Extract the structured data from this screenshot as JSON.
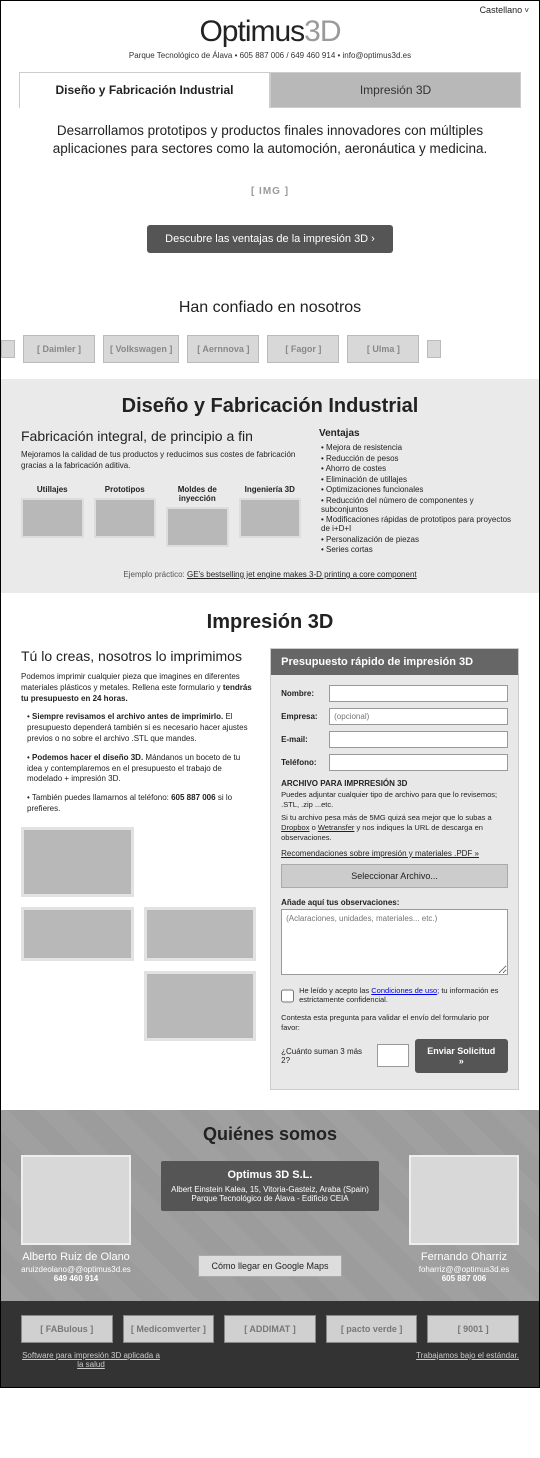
{
  "lang_selector": "Castellano",
  "logo_a": "Optimus",
  "logo_b": "3D",
  "sub_header": "Parque Tecnológico de Álava  •  605 887 006  /  649 460 914   •  info@optimus3d.es",
  "tabs": {
    "left": "Diseño y Fabricación Industrial",
    "right": "Impresión 3D"
  },
  "hero": {
    "headline": "Desarrollamos prototipos y productos finales innovadores con múltiples aplicaciones para sectores como la automoción, aeronáutica y medicina.",
    "img": "[ IMG ]",
    "cta": "Descubre las ventajas de la impresión 3D ›"
  },
  "trust": {
    "title": "Han confiado en nosotros",
    "logos": [
      "[ Daimler ]",
      "[ Volkswagen ]",
      "[ Aernnova ]",
      "[ Fagor ]",
      "[ Ulma ]"
    ]
  },
  "section_design": {
    "title": "Diseño y Fabricación Industrial",
    "sub": "Fabricación integral, de principio a fin",
    "desc": "Mejoramos la calidad de tus productos y reducimos sus costes de fabricación gracias a la fabricación aditiva.",
    "items": [
      "Utillajes",
      "Prototipos",
      "Moldes de inyección",
      "Ingeniería 3D"
    ],
    "adv_title": "Ventajas",
    "adv": [
      "Mejora de resistencia",
      "Reducción de pesos",
      "Ahorro de costes",
      "Eliminación de utillajes",
      "Optimizaciones funcionales",
      "Reducción del número de componentes y subconjuntos",
      "Modificaciones rápidas de prototipos para proyectos de i+D+I",
      "Personalización de piezas",
      "Series cortas"
    ],
    "example_pre": "Ejemplo práctico: ",
    "example_link": "GE's bestselling jet engine makes 3-D printing a core component"
  },
  "section_print": {
    "title": "Impresión 3D",
    "sub": "Tú lo creas, nosotros lo imprimimos",
    "p1a": "Podemos imprimir cualquier pieza que imagines en diferentes materiales plásticos y metales. Rellena este formulario y ",
    "p1b": "tendrás tu presupuesto en 24 horas.",
    "b1a": "Siempre revisamos el archivo antes de imprimirlo.",
    "b1b": " El presupuesto dependerá también si es necesario hacer ajustes previos o no sobre el archivo .STL que mandes.",
    "b2a": "Podemos hacer el diseño 3D.",
    "b2b": " Mándanos un boceto de tu idea y contemplaremos en el presupuesto el trabajo de modelado + impresión 3D.",
    "b3a": "También puedes llamarnos al teléfono: ",
    "b3b": "605 887 006",
    "b3c": " si lo prefieres."
  },
  "form": {
    "title": "Presupuesto rápido de impresión 3D",
    "name": "Nombre:",
    "company": "Empresa:",
    "company_ph": "(opcional)",
    "email": "E-mail:",
    "phone": "Teléfono:",
    "file_h": "ARCHIVO PARA IMPRRESIÓN 3D",
    "file_p1": "Puedes adjuntar cualquier tipo de archivo para que lo revisemos; .STL, .zip ...etc.",
    "file_p2a": "Si tu archivo pesa más de 5MG quizá sea mejor que lo subas a ",
    "file_dropbox": "Dropbox",
    "file_p2b": " o ",
    "file_wet": "Wetransfer",
    "file_p2c": " y nos indiques la URL de descarga en observaciones.",
    "rec_link": "Recomendaciones sobre impresión y materiales .PDF »",
    "file_btn": "Seleccionar Archivo...",
    "obs_h": "Añade aquí tus observaciones:",
    "obs_ph": "(Aclaraciones, unidades, materiales... etc.)",
    "chk_a": "He leído y acepto las ",
    "chk_link": "Condiciones de uso",
    "chk_b": "; tu información es estrictamente confidencial.",
    "captcha_pre": "Contesta esta pregunta para validar el envío del formulario por favor:",
    "captcha_q": "¿Cuánto suman 3 más 2?",
    "submit": "Enviar Solicitud »"
  },
  "about": {
    "title": "Quiénes somos",
    "company": "Optimus 3D S.L.",
    "addr1": "Albert Einstein Kalea, 15, Vitoria-Gasteiz, Araba (Spain)",
    "addr2": "Parque Tecnológico de Álava - Edificio CEIA",
    "maps": "Cómo llegar en Google Maps",
    "p1": {
      "name": "Alberto Ruiz de Olano",
      "email": "aruizdeolano@@optimus3d.es",
      "phone": "649 460 914"
    },
    "p2": {
      "name": "Fernando Oharriz",
      "email": "foharriz@@optimus3d.es",
      "phone": "605 887 006"
    }
  },
  "footer": {
    "logos": [
      "[ FABulous ]",
      "[ Medicomverter ]",
      "[ ADDIMAT ]",
      "[ pacto verde ]",
      "[ 9001 ]"
    ],
    "link1": "Software para impresión 3D aplicada a la salud",
    "link2": "Trabajamos bajo el estándar."
  }
}
